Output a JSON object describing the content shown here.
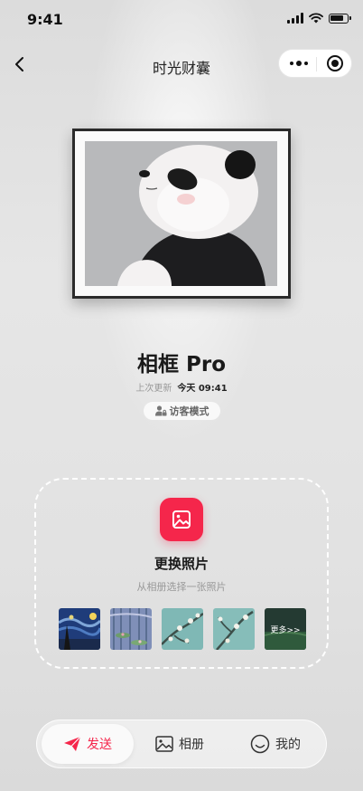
{
  "status_bar": {
    "time": "9:41"
  },
  "nav": {
    "title": "时光财囊"
  },
  "device": {
    "name": "相框 Pro",
    "updated_label": "上次更新",
    "updated_value": "今天 09:41",
    "mode_label": "访客模式"
  },
  "upload": {
    "title": "更换照片",
    "subtitle": "从相册选择一张照片",
    "more_label": "更多>>",
    "thumbnails": [
      "starry-night",
      "water-lilies",
      "almond-blossoms",
      "almond-blossoms",
      "green-landscape"
    ]
  },
  "tabbar": {
    "items": [
      {
        "label": "发送",
        "icon": "send-icon",
        "active": true
      },
      {
        "label": "相册",
        "icon": "image-icon",
        "active": false
      },
      {
        "label": "我的",
        "icon": "smile-icon",
        "active": false
      }
    ]
  },
  "colors": {
    "accent": "#f5264b",
    "background": "#e2e2e2"
  }
}
